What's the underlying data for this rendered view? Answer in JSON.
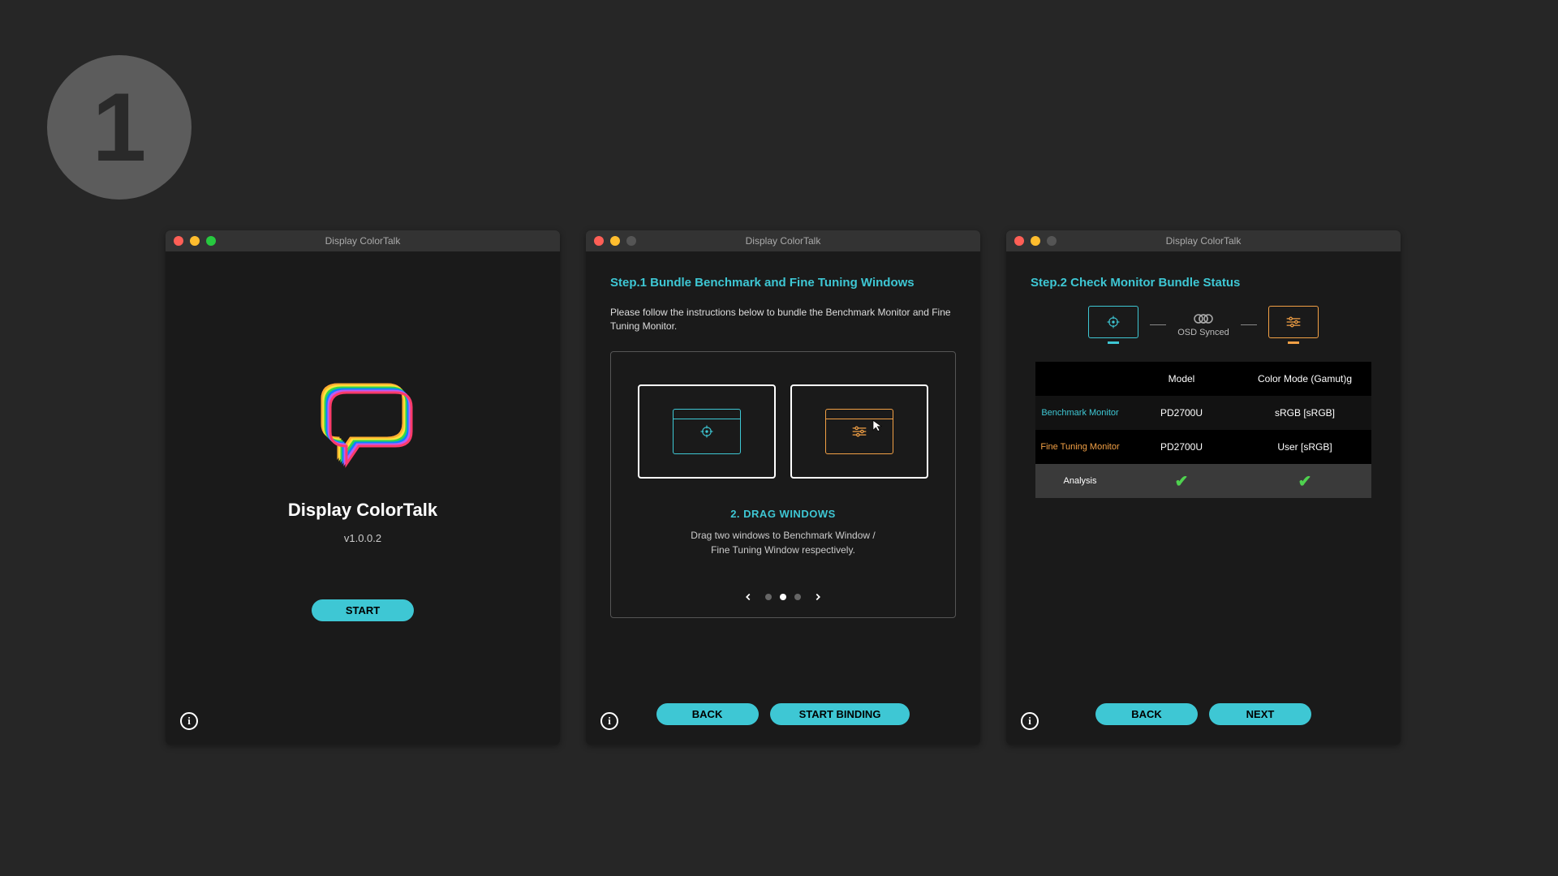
{
  "badge": {
    "number": "1"
  },
  "colors": {
    "accent": "#3ec7d4",
    "orange": "#f2a045",
    "green": "#4fd24f"
  },
  "window1": {
    "title": "Display ColorTalk",
    "app_name": "Display ColorTalk",
    "version": "v1.0.0.2",
    "start_label": "START"
  },
  "window2": {
    "title": "Display ColorTalk",
    "step_title": "Step.1  Bundle Benchmark and Fine Tuning Windows",
    "step_desc": "Please follow the instructions below to bundle the Benchmark Monitor and Fine Tuning Monitor.",
    "carousel": {
      "subtitle": "2. DRAG WINDOWS",
      "text1": "Drag two windows to Benchmark Window /",
      "text2": "Fine Tuning Window respectively.",
      "active_dot": 1,
      "total_dots": 3
    },
    "back_label": "BACK",
    "bind_label": "START BINDING"
  },
  "window3": {
    "title": "Display ColorTalk",
    "step_title": "Step.2  Check Monitor Bundle Status",
    "link_text": "OSD Synced",
    "table": {
      "headers": {
        "c1": "",
        "c2": "Model",
        "c3": "Color Mode (Gamut)g"
      },
      "rows": [
        {
          "label": "Benchmark Monitor",
          "class": "label-teal",
          "model": "PD2700U",
          "mode": "sRGB [sRGB]"
        },
        {
          "label": "Fine Tuning Monitor",
          "class": "label-orange",
          "model": "PD2700U",
          "mode": "User [sRGB]"
        }
      ],
      "analysis_label": "Analysis"
    },
    "back_label": "BACK",
    "next_label": "NEXT"
  }
}
